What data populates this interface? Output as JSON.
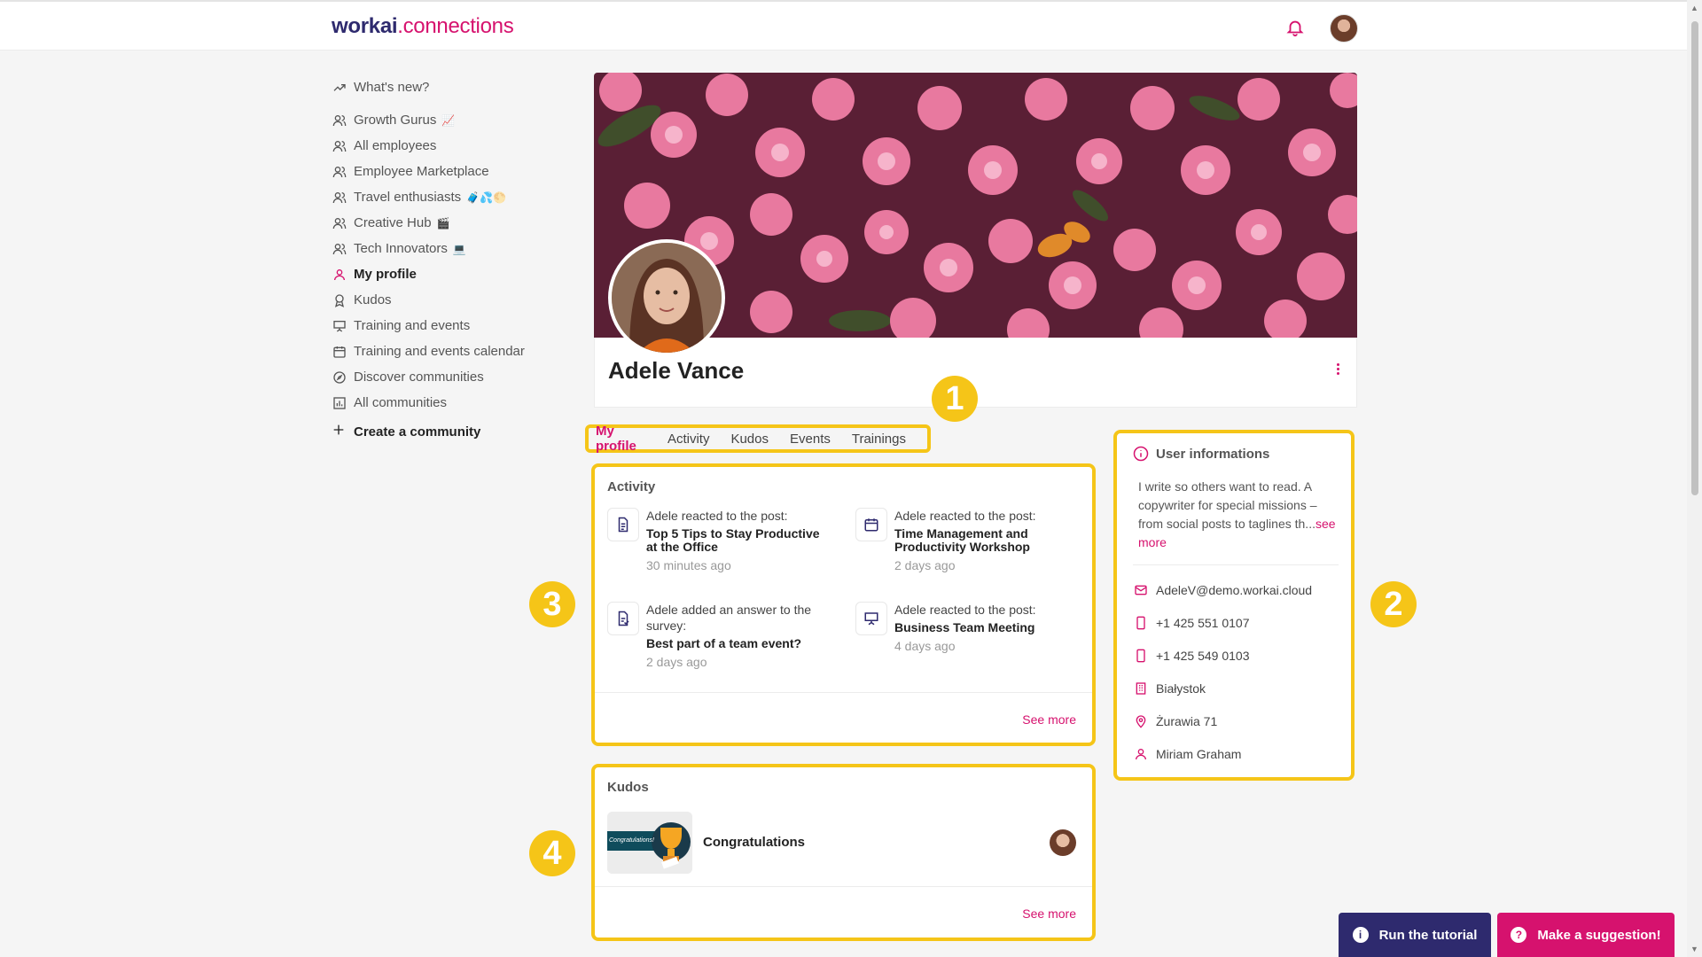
{
  "brand": {
    "part1": "workai",
    "part2": ".connections"
  },
  "colors": {
    "accent": "#d6126e",
    "brand_dark": "#2e2a6e",
    "highlight": "#f5c518"
  },
  "sidebar": {
    "items": [
      {
        "label": "What's new?",
        "icon": "trending-icon"
      },
      {
        "label": "Growth Gurus",
        "icon": "people-icon",
        "emoji": "📈"
      },
      {
        "label": "All employees",
        "icon": "people-icon"
      },
      {
        "label": "Employee Marketplace",
        "icon": "people-icon"
      },
      {
        "label": "Travel enthusiasts",
        "icon": "people-icon",
        "emoji": "🧳💦🌕"
      },
      {
        "label": "Creative Hub",
        "icon": "people-icon",
        "emoji": "🎬"
      },
      {
        "label": "Tech Innovators",
        "icon": "people-icon",
        "emoji": "💻"
      },
      {
        "label": "My profile",
        "icon": "user-icon"
      },
      {
        "label": "Kudos",
        "icon": "award-icon"
      },
      {
        "label": "Training and events",
        "icon": "presentation-icon"
      },
      {
        "label": "Training and events calendar",
        "icon": "calendar-icon"
      },
      {
        "label": "Discover communities",
        "icon": "compass-icon"
      },
      {
        "label": "All communities",
        "icon": "chart-icon"
      }
    ],
    "create_label": "Create a community"
  },
  "profile": {
    "name": "Adele Vance"
  },
  "tabs": [
    "My profile",
    "Activity",
    "Kudos",
    "Events",
    "Trainings"
  ],
  "badges": [
    "1",
    "2",
    "3",
    "4"
  ],
  "activity": {
    "title": "Activity",
    "items": [
      {
        "action": "Adele reacted to the post:",
        "post": "Top 5 Tips to Stay Productive at the Office",
        "time": "30 minutes ago",
        "icon": "document-icon"
      },
      {
        "action": "Adele reacted to the post:",
        "post": "Time Management and Productivity Workshop",
        "time": "2 days ago",
        "icon": "calendar-icon"
      },
      {
        "action": "Adele added an answer to the survey:",
        "post": "Best part of a team event?",
        "time": "2 days ago",
        "icon": "survey-icon"
      },
      {
        "action": "Adele reacted to the post:",
        "post": "Business Team Meeting",
        "time": "4 days ago",
        "icon": "presentation-icon"
      }
    ],
    "see_more": "See more"
  },
  "kudos": {
    "title": "Kudos",
    "item": "Congratulations",
    "image_text": "Congratulations!",
    "see_more": "See more"
  },
  "user_info": {
    "title": "User informations",
    "bio": "I write so others want to read. A copywriter for special missions – from social posts to taglines th...",
    "bio_more": "see more",
    "email": "AdeleV@demo.workai.cloud",
    "phone1": "+1 425 551 0107",
    "phone2": "+1 425 549 0103",
    "city": "Białystok",
    "address": "Żurawia 71",
    "manager": "Miriam Graham"
  },
  "buttons": {
    "tutorial": "Run the tutorial",
    "suggest": "Make a suggestion!"
  }
}
